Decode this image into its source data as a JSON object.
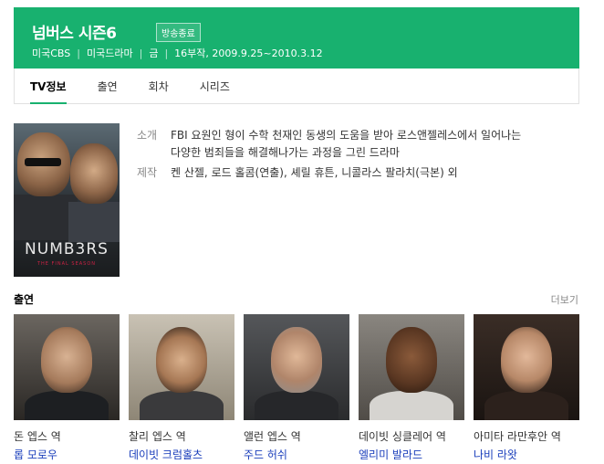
{
  "header": {
    "title": "넘버스 시즌6",
    "badge": "방송종료",
    "meta": [
      "미국CBS",
      "미국드라마",
      "금",
      "16부작, 2009.9.25~2010.3.12"
    ],
    "color": "#18b16f"
  },
  "tabs": [
    "TV정보",
    "출연",
    "회차",
    "시리즈"
  ],
  "poster": {
    "logo": "NUMB3RS",
    "subtitle": "THE FINAL SEASON"
  },
  "info": {
    "intro_label": "소개",
    "intro_line1": "FBI 요원인 형이 수학 천재인 동생의 도움을 받아 로스앤젤레스에서 일어나는",
    "intro_line2": "다양한 범죄들을 해결해나가는 과정을 그린 드라마",
    "producer_label": "제작",
    "producer": "켄 산젤, 로드 홀콤(연출), 셰릴 휴튼, 니콜라스 팔라치(극본) 외"
  },
  "cast_section": {
    "title": "출연",
    "more": "더보기"
  },
  "cast": [
    {
      "role": "돈 엡스 역",
      "actor": "롭 모로우"
    },
    {
      "role": "찰리 엡스 역",
      "actor": "데이빗 크럼홀츠"
    },
    {
      "role": "앨런 엡스 역",
      "actor": "주드 허쉬"
    },
    {
      "role": "데이빗 싱클레어 역",
      "actor": "엘리미 발라드"
    },
    {
      "role": "아미타 라만후안 역",
      "actor": "나비 라왓"
    }
  ]
}
